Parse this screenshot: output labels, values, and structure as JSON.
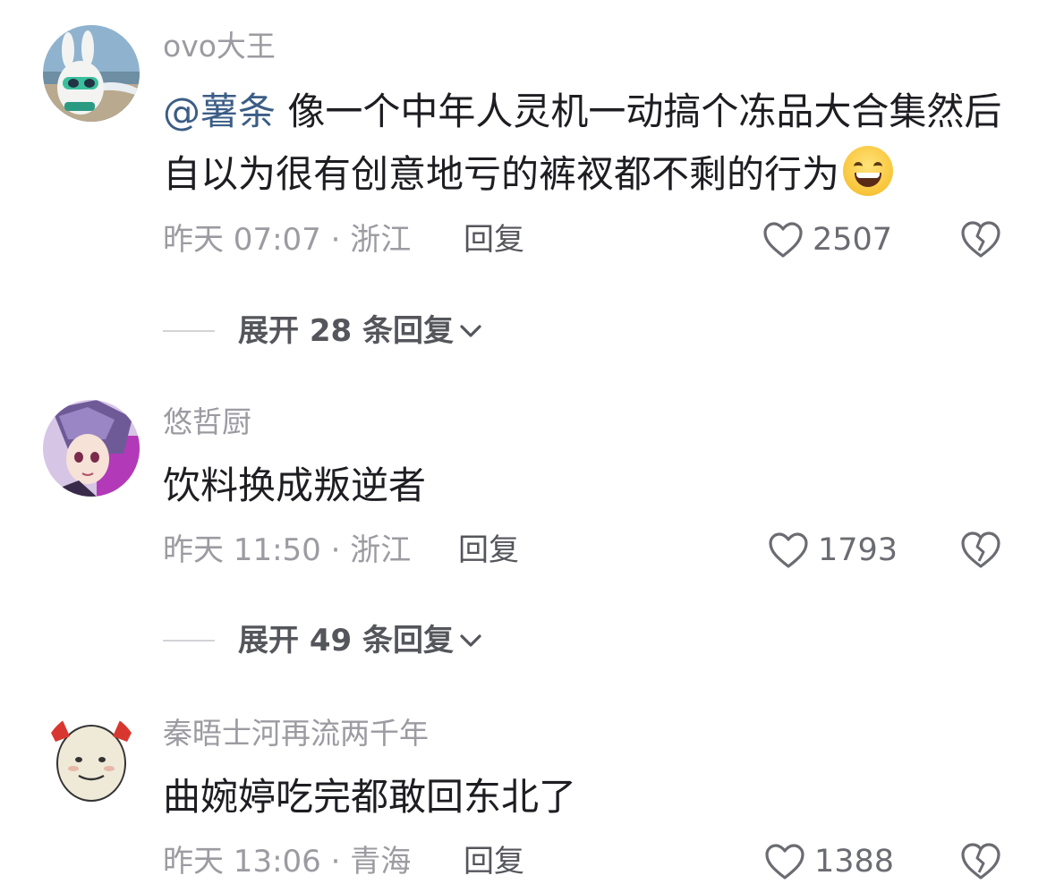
{
  "colors": {
    "background": "#ffffff",
    "username": "#9b9ba1",
    "text": "#1d1d22",
    "mention": "#3b5d86",
    "meta": "#9b9ba1",
    "action": "#55565c"
  },
  "comments": [
    {
      "username": "ovo大王",
      "mention": "@薯条",
      "text": " 像一个中年人灵机一动搞个冻品大合集然后自以为很有创意地亏的裤衩都不剩的行为",
      "emoji": "grinning-sweat-emoji",
      "time_location": "昨天 07:07 · 浙江",
      "reply_label": "回复",
      "likes": "2507",
      "expand_label": "展开 28 条回复"
    },
    {
      "username": "悠哲厨",
      "text": "饮料换成叛逆者",
      "time_location": "昨天 11:50 · 浙江",
      "reply_label": "回复",
      "likes": "1793",
      "expand_label": "展开 49 条回复"
    },
    {
      "username": "秦晤士河再流两千年",
      "text": "曲婉婷吃完都敢回东北了",
      "time_location": "昨天 13:06 · 青海",
      "reply_label": "回复",
      "likes": "1388"
    }
  ]
}
